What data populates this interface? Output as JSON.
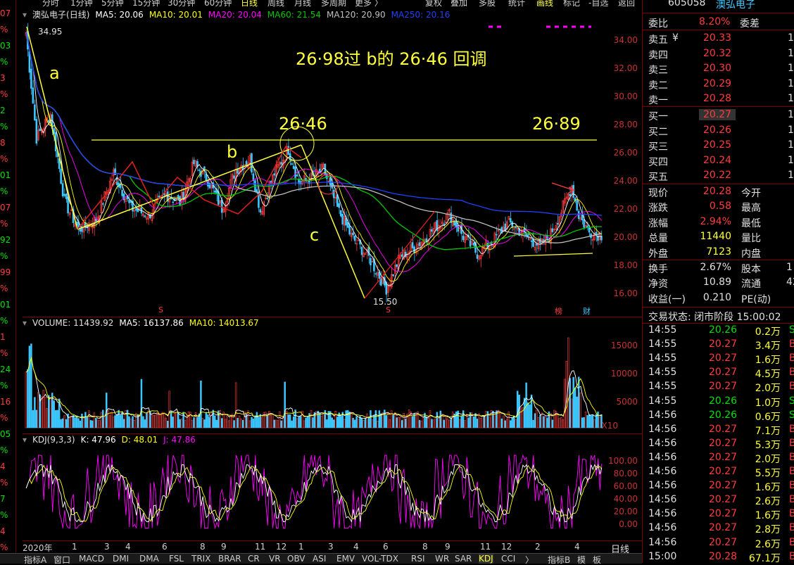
{
  "menu": [
    "分时",
    "1分钟",
    "5分钟",
    "15分钟",
    "30分钟",
    "60分钟",
    "日线",
    "周线",
    "月线",
    "多周期",
    "更多 〉",
    "复权",
    "叠加",
    "多股",
    "统计",
    "画线",
    "标记",
    "-自选",
    "返回"
  ],
  "left_strip": [
    "07",
    "%",
    "03",
    "%",
    "3",
    "%",
    "2",
    "%",
    "8",
    "%",
    "01",
    "%",
    "07",
    "%",
    "92",
    "%",
    "99",
    "%",
    "01",
    "%",
    "1",
    "%",
    "24",
    "%",
    "16",
    "%",
    "05",
    "%",
    "4",
    "%",
    "7",
    "%",
    "4",
    "%"
  ],
  "main_header": {
    "title": "澳弘电子(日线)",
    "ma5": "MA5: 20.06",
    "ma10": "MA10: 20.01",
    "ma20": "MA20: 20.04",
    "ma60": "MA60: 21.54",
    "ma120": "MA120: 20.90",
    "ma250": "MA250: 20.16"
  },
  "price_axis": [
    "34.00",
    "32.00",
    "30.00",
    "28.00",
    "26.00",
    "24.00",
    "22.00",
    "20.00",
    "18.00",
    "16.00"
  ],
  "annotations": {
    "headline": "26·98过 b的 26·46 回调",
    "a": "a",
    "b": "b",
    "c": "c",
    "high1": "26·46",
    "high2": "26·89",
    "max_label": "34.95",
    "min_label": "15.50",
    "marker_s": "S",
    "marker_bang": "榜",
    "marker_cai": "财"
  },
  "volume_header": {
    "label": "VOLUME: 11439.92",
    "ma5": "MA5: 16137.86",
    "ma10": "MA10: 14013.67"
  },
  "volume_axis": [
    "15000",
    "10000",
    "5000"
  ],
  "volume_unit": "X10",
  "kdj_header": {
    "label": "KDJ(9,3,3)",
    "k": "K: 47.96",
    "d": "D: 48.01",
    "j": "J: 47.86"
  },
  "kdj_axis": [
    "100.00",
    "80.00",
    "60.00",
    "40.00",
    "20.00",
    "0.00"
  ],
  "dates": [
    "2020年",
    "1",
    "3",
    "4",
    "6",
    "8",
    "9",
    "11",
    "12",
    "1",
    "3",
    "4",
    "6",
    "8",
    "9",
    "11",
    "12",
    "2",
    "4"
  ],
  "period_label": "日线",
  "tabs": [
    "指标A",
    "窗口",
    "MACD",
    "DMI",
    "DMA",
    "FSL",
    "TRIX",
    "BRAR",
    "CR",
    "VR",
    "OBV",
    "ASI",
    "EMV",
    "VOL-TDX",
    "RSI",
    "WR",
    "SAR",
    "KDJ",
    "CCI",
    "〉",
    "指标B",
    "模",
    "板"
  ],
  "quote": {
    "code": "605058",
    "name": "澳弘电子",
    "weibi_label": "委比",
    "weibi": "8.20%",
    "weicha_label": "委差",
    "sell": [
      {
        "label": "卖五",
        "flag": "¥",
        "price": "20.33"
      },
      {
        "label": "卖四",
        "price": "20.32"
      },
      {
        "label": "卖三",
        "price": "20.30"
      },
      {
        "label": "卖二",
        "price": "20.29"
      },
      {
        "label": "卖一",
        "price": "20.28"
      }
    ],
    "buy": [
      {
        "label": "买一",
        "price": "20.27"
      },
      {
        "label": "买二",
        "price": "20.26"
      },
      {
        "label": "买三",
        "price": "20.25"
      },
      {
        "label": "买四",
        "price": "20.24"
      },
      {
        "label": "买五",
        "price": "20.22"
      }
    ],
    "stats": [
      {
        "l1": "现价",
        "v1": "20.28",
        "l2": "今开"
      },
      {
        "l1": "涨跌",
        "v1": "0.58",
        "l2": "最高"
      },
      {
        "l1": "涨幅",
        "v1": "2.94%",
        "l2": "最低"
      },
      {
        "l1": "总量",
        "v1": "11440",
        "l2": "量比"
      },
      {
        "l1": "外盘",
        "v1": "7123",
        "l2": "内盘"
      }
    ],
    "stats2": [
      {
        "l1": "换手",
        "v1": "2.67%",
        "l2": "股本"
      },
      {
        "l1": "净资",
        "v1": "10.89",
        "l2": "流通"
      },
      {
        "l1": "收益(一)",
        "v1": "0.210",
        "l2": "PE(动)"
      }
    ],
    "stats2_tail": [
      "1",
      "42",
      ""
    ],
    "status": "交易状态: 闭市阶段 15:00:02",
    "ticks": [
      {
        "t": "14:55",
        "p": "20.26",
        "v": "0.2万",
        "c": "green"
      },
      {
        "t": "14:55",
        "p": "20.27",
        "v": "3.4万",
        "c": "red"
      },
      {
        "t": "14:55",
        "p": "20.27",
        "v": "1.6万",
        "c": "red"
      },
      {
        "t": "14:55",
        "p": "20.27",
        "v": "4.5万",
        "c": "red"
      },
      {
        "t": "14:55",
        "p": "20.27",
        "v": "2.0万",
        "c": "red"
      },
      {
        "t": "14:55",
        "p": "20.26",
        "v": "1.0万",
        "c": "green"
      },
      {
        "t": "14:56",
        "p": "20.26",
        "v": "0.6万",
        "c": "green"
      },
      {
        "t": "14:56",
        "p": "20.27",
        "v": "7.1万",
        "c": "red"
      },
      {
        "t": "14:56",
        "p": "20.27",
        "v": "5.3万",
        "c": "red"
      },
      {
        "t": "14:56",
        "p": "20.27",
        "v": "2.0万",
        "c": "red"
      },
      {
        "t": "14:56",
        "p": "20.27",
        "v": "5.5万",
        "c": "red"
      },
      {
        "t": "14:56",
        "p": "20.27",
        "v": "1.6万",
        "c": "red"
      },
      {
        "t": "14:56",
        "p": "20.27",
        "v": "2.6万",
        "c": "red"
      },
      {
        "t": "14:56",
        "p": "20.27",
        "v": "1.6万",
        "c": "red"
      },
      {
        "t": "14:56",
        "p": "20.27",
        "v": "2.8万",
        "c": "red"
      },
      {
        "t": "14:56",
        "p": "20.27",
        "v": "2.6万",
        "c": "red"
      },
      {
        "t": "15:00",
        "p": "20.28",
        "v": "67.1万",
        "c": "red"
      }
    ]
  },
  "colors": {
    "up": "#ff3c3c",
    "down": "#3cc8ff",
    "ma5": "#ffffff",
    "ma10": "#ffff00",
    "ma20": "#ff00ff",
    "ma60": "#00c800",
    "ma120": "#c0c0c0",
    "ma250": "#2040ff",
    "annotation": "#ffff3c"
  }
}
